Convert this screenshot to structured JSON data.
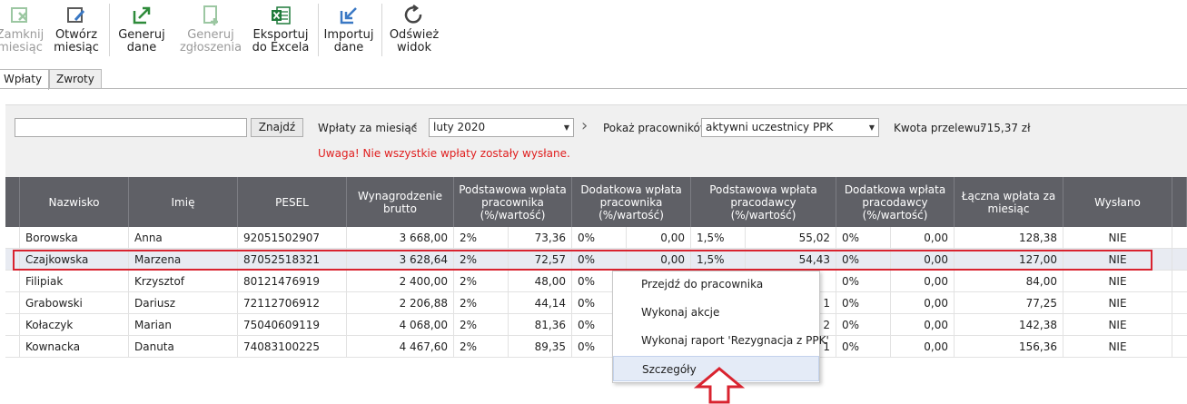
{
  "toolbar": {
    "close_month": {
      "line1": "Zamknij",
      "line2": "miesiąc"
    },
    "open_month": {
      "line1": "Otwórz",
      "line2": "miesiąc"
    },
    "generate_data": {
      "line1": "Generuj",
      "line2": "dane"
    },
    "generate_reports": {
      "line1": "Generuj",
      "line2": "zgłoszenia"
    },
    "export_excel": {
      "line1": "Eksportuj",
      "line2": "do Excela"
    },
    "import_data": {
      "line1": "Importuj",
      "line2": "dane"
    },
    "refresh_view": {
      "line1": "Odśwież",
      "line2": "widok"
    }
  },
  "tabs": [
    {
      "label": "Wpłaty",
      "active": true
    },
    {
      "label": "Zwroty",
      "active": false
    }
  ],
  "filters": {
    "search_value": "",
    "search_button": "Znajdź",
    "month_label": "Wpłaty za miesiąc",
    "month_value": "luty 2020",
    "employees_label": "Pokaż pracowników",
    "employees_value": "aktywni uczestnicy PPK",
    "transfer_label": "Kwota przelewu:",
    "transfer_value": "715,37 zł",
    "warning": "Uwaga! Nie wszystkie wpłaty zostały wysłane."
  },
  "table": {
    "headers": {
      "surname": "Nazwisko",
      "name": "Imię",
      "pesel": "PESEL",
      "salary": [
        "Wynagrodzenie",
        "brutto"
      ],
      "basic_employee": [
        "Podstawowa wpłata",
        "pracownika",
        "(%/wartość)"
      ],
      "extra_employee": [
        "Dodatkowa wpłata",
        "pracownika",
        "(%/wartość)"
      ],
      "basic_employer": [
        "Podstawowa wpłata",
        "pracodawcy",
        "(%/wartość)"
      ],
      "extra_employer": [
        "Dodatkowa wpłata",
        "pracodawcy",
        "(%/wartość)"
      ],
      "total": [
        "Łączna wpłata za",
        "miesiąc"
      ],
      "sent": "Wysłano"
    },
    "rows": [
      {
        "surname": "Borowska",
        "name": "Anna",
        "pesel": "92051502907",
        "salary": "3 668,00",
        "be_pct": "2%",
        "be_val": "73,36",
        "ee_pct": "0%",
        "ee_val": "0,00",
        "br_pct": "1,5%",
        "br_val": "55,02",
        "er_pct": "0%",
        "er_val": "0,00",
        "total": "128,38",
        "sent": "NIE"
      },
      {
        "surname": "Czajkowska",
        "name": "Marzena",
        "pesel": "87052518321",
        "salary": "3 628,64",
        "be_pct": "2%",
        "be_val": "72,57",
        "ee_pct": "0%",
        "ee_val": "0,00",
        "br_pct": "1,5%",
        "br_val": "54,43",
        "er_pct": "0%",
        "er_val": "0,00",
        "total": "127,00",
        "sent": "NIE"
      },
      {
        "surname": "Filipiak",
        "name": "Krzysztof",
        "pesel": "80121476919",
        "salary": "2 400,00",
        "be_pct": "2%",
        "be_val": "48,00",
        "ee_pct": "0%",
        "ee_val": "",
        "br_pct": "",
        "br_val": "",
        "er_pct": "0%",
        "er_val": "0,00",
        "total": "84,00",
        "sent": "NIE"
      },
      {
        "surname": "Grabowski",
        "name": "Dariusz",
        "pesel": "72112706912",
        "salary": "2 206,88",
        "be_pct": "2%",
        "be_val": "44,14",
        "ee_pct": "0%",
        "ee_val": "",
        "br_pct": "",
        "br_val": "1",
        "er_pct": "0%",
        "er_val": "0,00",
        "total": "77,25",
        "sent": "NIE"
      },
      {
        "surname": "Kołaczyk",
        "name": "Marian",
        "pesel": "75040609119",
        "salary": "4 068,00",
        "be_pct": "2%",
        "be_val": "81,36",
        "ee_pct": "0%",
        "ee_val": "",
        "br_pct": "",
        "br_val": "2",
        "er_pct": "0%",
        "er_val": "0,00",
        "total": "142,38",
        "sent": "NIE"
      },
      {
        "surname": "Kownacka",
        "name": "Danuta",
        "pesel": "74083100225",
        "salary": "4 467,60",
        "be_pct": "2%",
        "be_val": "89,35",
        "ee_pct": "0%",
        "ee_val": "",
        "br_pct": "",
        "br_val": "1",
        "er_pct": "0%",
        "er_val": "0,00",
        "total": "156,36",
        "sent": "NIE"
      }
    ]
  },
  "context_menu": [
    "Przejdź do pracownika",
    "Wykonaj akcje",
    "Wykonaj raport 'Rezygnacja z PPK'",
    "Szczegóły"
  ],
  "colors": {
    "header_bg": "#5f6066",
    "warning": "#e02020",
    "highlight_outline": "#d9232f",
    "accent_green": "#2e8b3a"
  }
}
